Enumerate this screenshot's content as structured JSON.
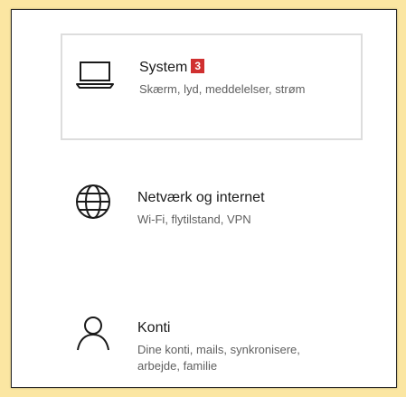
{
  "settings": {
    "items": [
      {
        "title": "System",
        "badge": "3",
        "description": "Skærm, lyd, meddelelser, strøm",
        "icon": "laptop-icon"
      },
      {
        "title": "Netværk og internet",
        "description": "Wi-Fi, flytilstand, VPN",
        "icon": "globe-icon"
      },
      {
        "title": "Konti",
        "description": "Dine konti, mails, synkronisere, arbejde, familie",
        "icon": "person-icon"
      }
    ]
  },
  "colors": {
    "badge": "#d03030",
    "background": "#fbe6a2",
    "selection_border": "#dddddd"
  }
}
